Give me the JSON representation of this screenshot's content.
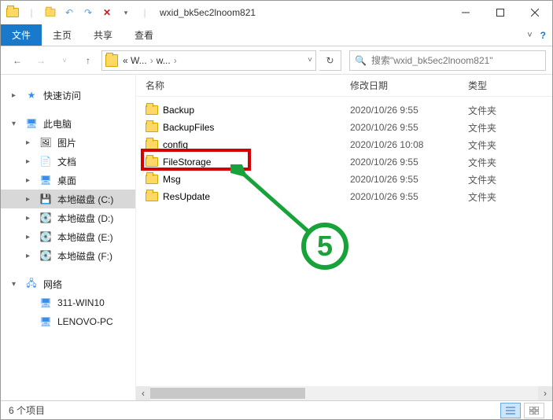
{
  "window": {
    "title": "wxid_bk5ec2lnoom821"
  },
  "ribbon": {
    "file": "文件",
    "home": "主页",
    "share": "共享",
    "view": "查看"
  },
  "breadcrumb": {
    "part1": "« W...",
    "part2": "w..."
  },
  "search": {
    "placeholder": "搜索\"wxid_bk5ec2lnoom821\""
  },
  "sidebar": {
    "quick_access": "快速访问",
    "this_pc": "此电脑",
    "pictures": "图片",
    "documents": "文档",
    "desktop": "桌面",
    "drive_c": "本地磁盘 (C:)",
    "drive_d": "本地磁盘 (D:)",
    "drive_e": "本地磁盘 (E:)",
    "drive_f": "本地磁盘 (F:)",
    "network": "网络",
    "net1": "311-WIN10",
    "net2": "LENOVO-PC"
  },
  "columns": {
    "name": "名称",
    "date": "修改日期",
    "type": "类型"
  },
  "rows": [
    {
      "name": "Backup",
      "date": "2020/10/26 9:55",
      "type": "文件夹"
    },
    {
      "name": "BackupFiles",
      "date": "2020/10/26 9:55",
      "type": "文件夹"
    },
    {
      "name": "config",
      "date": "2020/10/26 10:08",
      "type": "文件夹"
    },
    {
      "name": "FileStorage",
      "date": "2020/10/26 9:55",
      "type": "文件夹"
    },
    {
      "name": "Msg",
      "date": "2020/10/26 9:55",
      "type": "文件夹"
    },
    {
      "name": "ResUpdate",
      "date": "2020/10/26 9:55",
      "type": "文件夹"
    }
  ],
  "status": {
    "count": "6 个项目"
  },
  "annotation": {
    "step": "5"
  }
}
